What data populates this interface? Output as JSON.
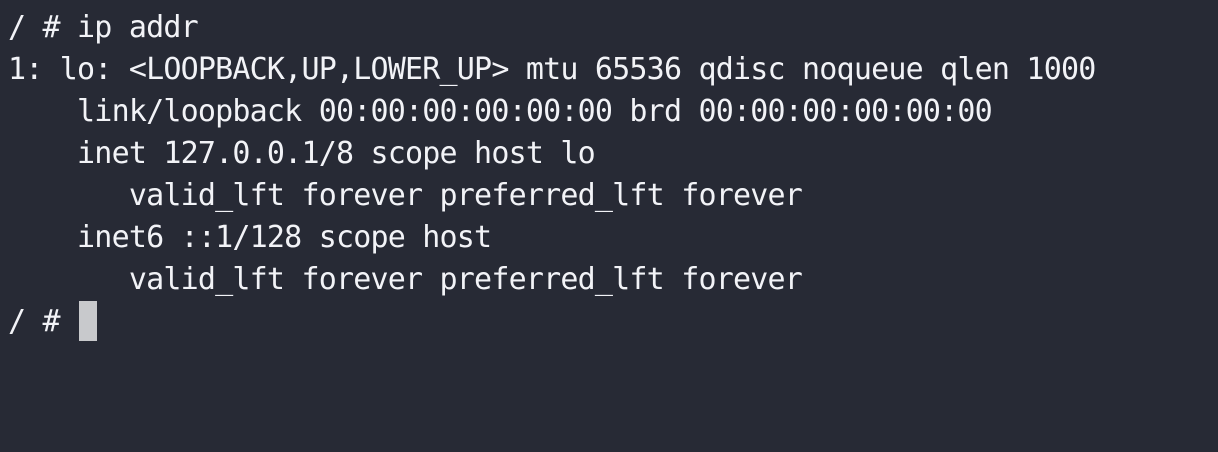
{
  "terminal": {
    "lines": [
      "/ # ip addr",
      "1: lo: <LOOPBACK,UP,LOWER_UP> mtu 65536 qdisc noqueue qlen 1000",
      "    link/loopback 00:00:00:00:00:00 brd 00:00:00:00:00:00",
      "    inet 127.0.0.1/8 scope host lo",
      "       valid_lft forever preferred_lft forever",
      "    inet6 ::1/128 scope host",
      "       valid_lft forever preferred_lft forever"
    ],
    "prompt": "/ # ",
    "colors": {
      "background": "#272a35",
      "foreground": "#f2f3f7",
      "cursor": "#c8c9cc"
    }
  }
}
